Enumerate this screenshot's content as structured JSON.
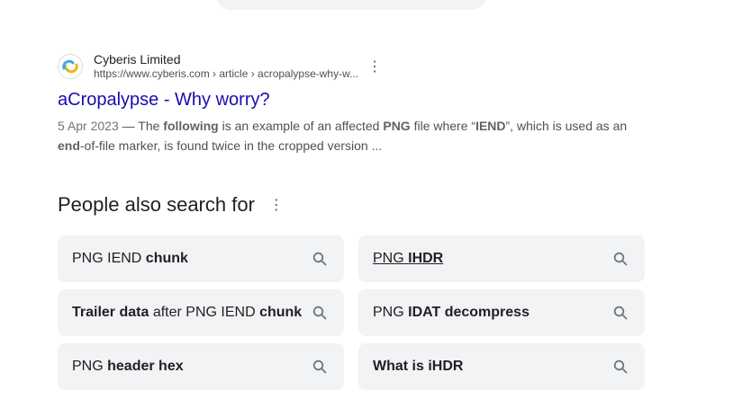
{
  "result": {
    "site_name": "Cyberis Limited",
    "site_url": "https://www.cyberis.com › article › acropalypse-why-w...",
    "title": "aCropalypse - Why worry?",
    "date": "5 Apr 2023",
    "snippet_parts": [
      " — The ",
      "following",
      " is an example of an affected ",
      "PNG",
      " file where “",
      "IEND",
      "”, which is used as an ",
      "end",
      "-of-file marker, is found twice in the cropped version ..."
    ]
  },
  "people_also_search": {
    "title": "People also search for",
    "items": [
      {
        "normal": "PNG IEND ",
        "bold": "chunk"
      },
      {
        "normal": "PNG ",
        "bold": "IHDR"
      },
      {
        "bold_a": "Trailer data",
        "normal": " after PNG IEND ",
        "bold": "chunk"
      },
      {
        "normal": "PNG ",
        "bold": "IDAT decompress"
      },
      {
        "normal": "PNG ",
        "bold": "header hex"
      },
      {
        "bold": "What is iHDR"
      }
    ]
  },
  "icons": {
    "favicon": "cyberis-logo-icon",
    "more": "more-vert-icon",
    "search": "search-icon"
  }
}
